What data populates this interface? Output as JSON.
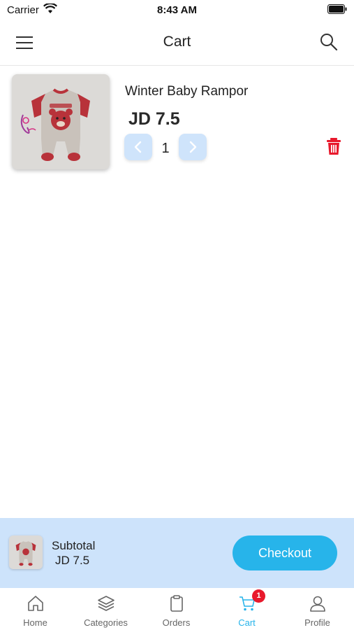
{
  "status_bar": {
    "carrier": "Carrier",
    "time": "8:43 AM"
  },
  "nav": {
    "title": "Cart",
    "icons": [
      "menu-icon",
      "search-icon"
    ]
  },
  "cart_items": [
    {
      "name": "Winter Baby Rampor",
      "price": "JD 7.5",
      "quantity": "1"
    }
  ],
  "subtotal": {
    "label": "Subtotal",
    "value": "JD 7.5",
    "checkout_label": "Checkout"
  },
  "tabs": [
    {
      "label": "Home",
      "icon": "home-icon"
    },
    {
      "label": "Categories",
      "icon": "layers-icon"
    },
    {
      "label": "Orders",
      "icon": "clipboard-icon"
    },
    {
      "label": "Cart",
      "icon": "cart-icon",
      "badge": "1",
      "active": true
    },
    {
      "label": "Profile",
      "icon": "user-icon"
    }
  ],
  "colors": {
    "accent": "#27b4ea",
    "badge": "#e8192c",
    "subtotal_bg": "#cde3fb",
    "qty_button_bg": "#cfe4fb",
    "delete": "#e8192c"
  }
}
